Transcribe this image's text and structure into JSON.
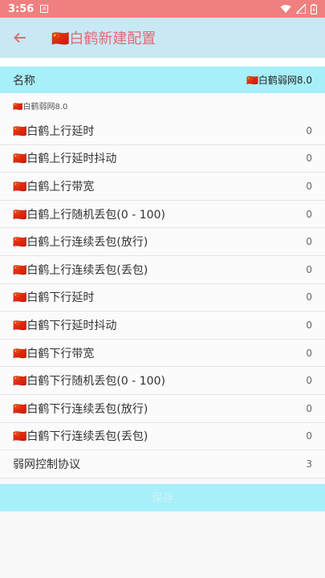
{
  "status_bar": {
    "time": "3:56",
    "notification_glyph": "A"
  },
  "app_bar": {
    "title": "🇨🇳白鹤新建配置",
    "back_icon": "arrow-left-icon",
    "accent_color": "#e06c75",
    "background": "#c8e8f4"
  },
  "name_field": {
    "label": "名称",
    "value": "🇨🇳白鹤弱网8.0"
  },
  "subtitle": "🇨🇳白鹤弱网8.0",
  "rows": [
    {
      "label": "🇨🇳白鹤上行延时",
      "value": "0"
    },
    {
      "label": "🇨🇳白鹤上行延时抖动",
      "value": "0"
    },
    {
      "label": "🇨🇳白鹤上行带宽",
      "value": "0"
    },
    {
      "label": "🇨🇳白鹤上行随机丢包(0 - 100)",
      "value": "0"
    },
    {
      "label": "🇨🇳白鹤上行连续丢包(放行)",
      "value": "0"
    },
    {
      "label": "🇨🇳白鹤上行连续丢包(丢包)",
      "value": "0"
    },
    {
      "label": "🇨🇳白鹤下行延时",
      "value": "0"
    },
    {
      "label": "🇨🇳白鹤下行延时抖动",
      "value": "0"
    },
    {
      "label": "🇨🇳白鹤下行带宽",
      "value": "0"
    },
    {
      "label": "🇨🇳白鹤下行随机丢包(0 - 100)",
      "value": "0"
    },
    {
      "label": "🇨🇳白鹤下行连续丢包(放行)",
      "value": "0"
    },
    {
      "label": "🇨🇳白鹤下行连续丢包(丢包)",
      "value": "0"
    },
    {
      "label": "弱网控制协议",
      "value": "3"
    }
  ],
  "save_button": {
    "label": "保存",
    "background": "#a7eff9"
  }
}
